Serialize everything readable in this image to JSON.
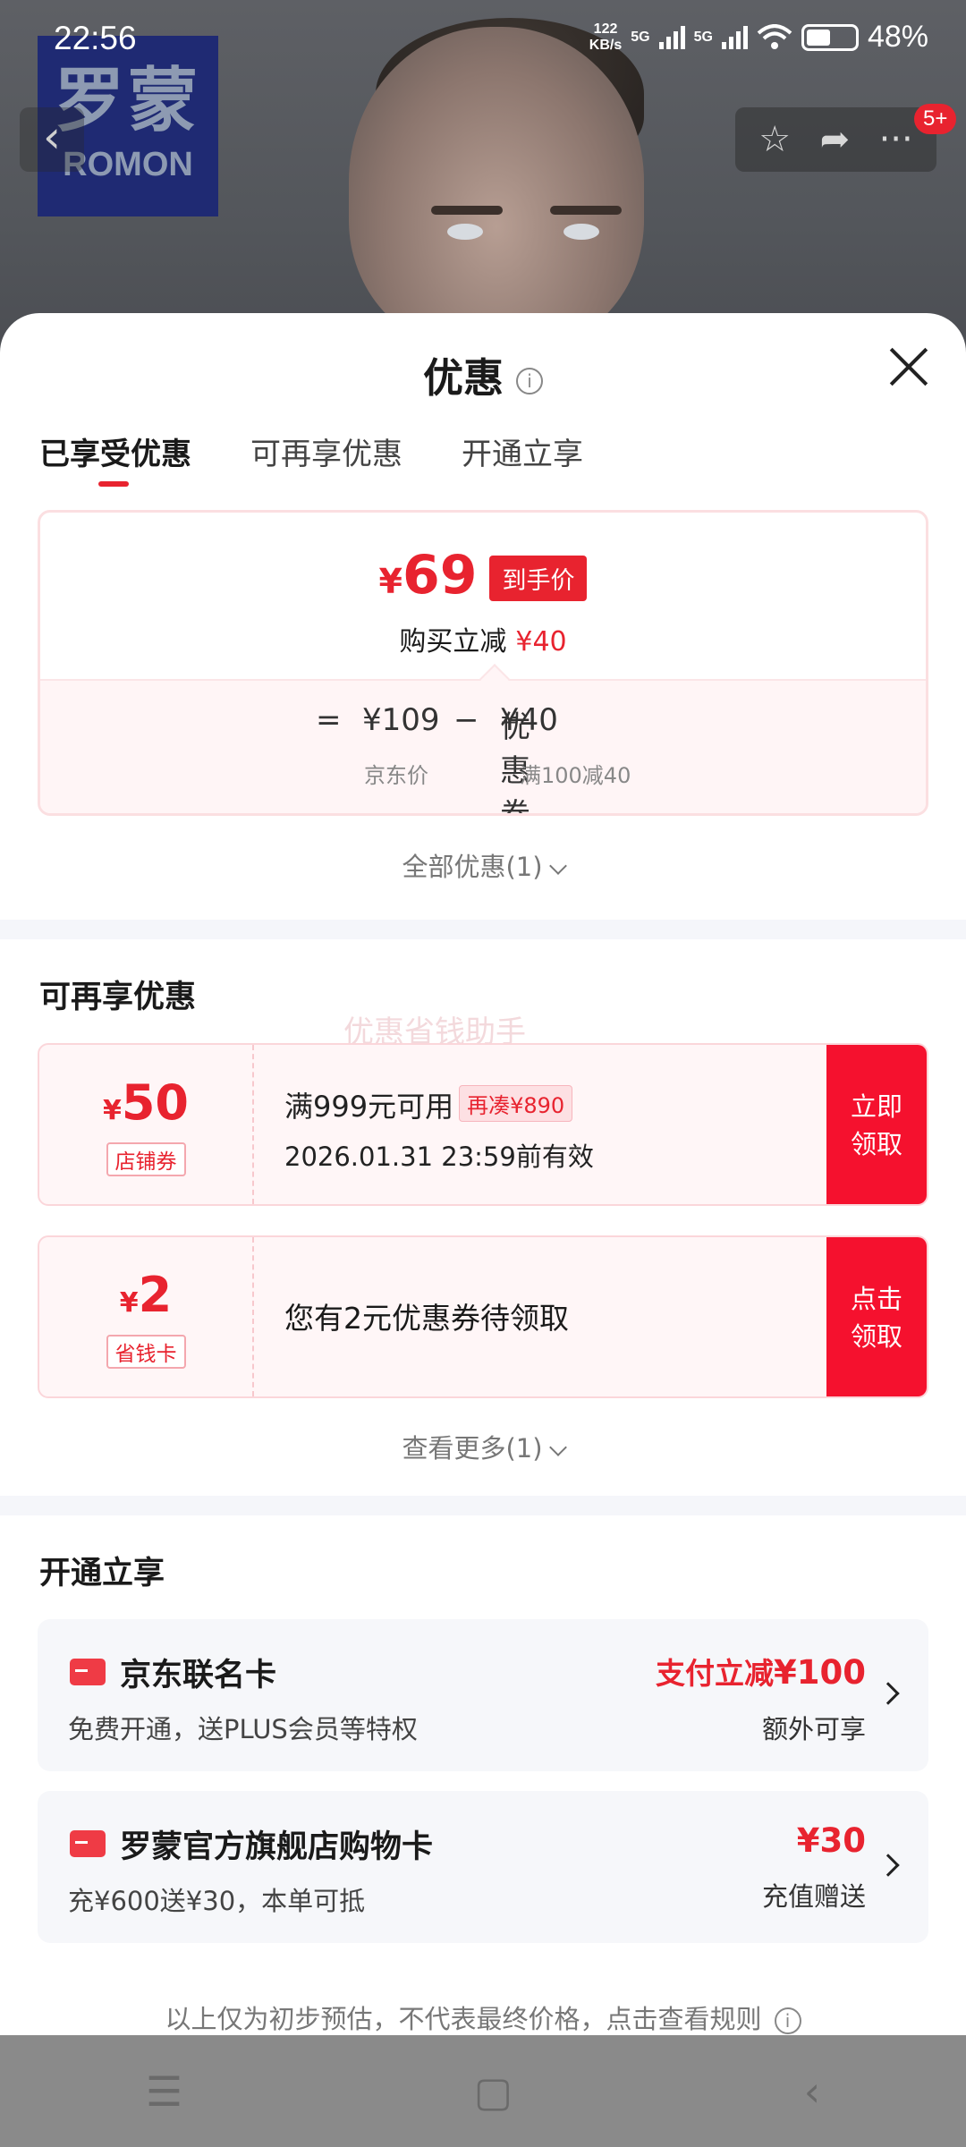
{
  "status_bar": {
    "time": "22:56",
    "net_speed": "122",
    "net_unit": "KB/s",
    "sig1": "5G",
    "sig2": "5G",
    "battery": "48%"
  },
  "background": {
    "logo_cn": "罗蒙",
    "logo_en": "ROMON",
    "cart_badge": "5+"
  },
  "sheet": {
    "title": "优惠",
    "tabs": [
      "已享受优惠",
      "可再享优惠",
      "开通立享"
    ],
    "active_tab": 0
  },
  "final_price": {
    "currency": "¥",
    "amount": "69",
    "tag": "到手价",
    "reduce_label": "购买立减",
    "reduce_value": "¥40",
    "equals": "=",
    "jd_price": "¥109",
    "minus": "−",
    "coupon_label": "优惠券",
    "coupon_value": "¥40",
    "jd_price_label": "京东价",
    "coupon_rule": "满100减40"
  },
  "all_promos": "全部优惠(1)",
  "section_more": {
    "title": "可再享优惠",
    "watermark": "优惠省钱助手"
  },
  "coupons": [
    {
      "currency": "¥",
      "amount": "50",
      "kind": "店铺券",
      "condition": "满999元可用",
      "extra": "再凑¥890",
      "expiry": "2026.01.31 23:59前有效",
      "btn_l1": "立即",
      "btn_l2": "领取"
    },
    {
      "currency": "¥",
      "amount": "2",
      "kind": "省钱卡",
      "text": "您有2元优惠券待领取",
      "btn_l1": "点击",
      "btn_l2": "领取"
    }
  ],
  "see_more": "查看更多(1)",
  "section_open": {
    "title": "开通立享"
  },
  "cards": [
    {
      "name": "京东联名卡",
      "desc": "免费开通，送PLUS会员等特权",
      "right_prefix": "支付立减",
      "right_value": "¥100",
      "right_sub": "额外可享"
    },
    {
      "name": "罗蒙官方旗舰店购物卡",
      "desc": "充¥600送¥30，本单可抵",
      "right_prefix": "",
      "right_value": "¥30",
      "right_sub": "充值赠送"
    }
  ],
  "disclaimer": "以上仅为初步预估，不代表最终价格，点击查看规则",
  "icons": {
    "back": "chevron-left-icon",
    "star": "star-icon",
    "share": "share-icon",
    "more": "more-icon",
    "close": "close-icon",
    "info": "info-icon",
    "menu": "menu-icon",
    "home": "home-icon",
    "nav_back": "back-icon"
  },
  "colors": {
    "accent": "#e8232f",
    "coupon_bg": "#fff6f7",
    "card_bg": "#f6f7fa"
  }
}
